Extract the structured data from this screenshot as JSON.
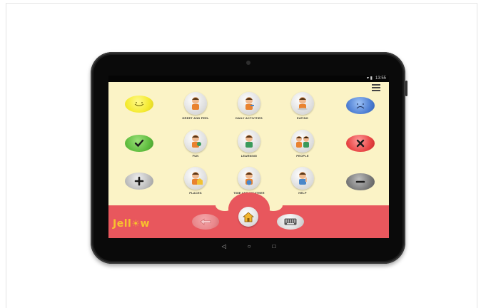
{
  "status": {
    "time": "13:55",
    "icons": "▾ ▮"
  },
  "side_buttons": {
    "left": [
      {
        "name": "yes-smile-button",
        "color": "#f4ea2f",
        "symbol": "smile-icon"
      },
      {
        "name": "yes-check-button",
        "color": "#5fbd3f",
        "symbol": "check-icon"
      },
      {
        "name": "more-plus-button",
        "color": "#b9b9b9",
        "symbol": "plus-icon"
      }
    ],
    "right": [
      {
        "name": "no-sad-button",
        "color": "#4e7fd4",
        "symbol": "sad-icon"
      },
      {
        "name": "no-cross-button",
        "color": "#e84545",
        "symbol": "cross-icon"
      },
      {
        "name": "less-minus-button",
        "color": "#7a7a7a",
        "symbol": "minus-icon"
      }
    ]
  },
  "categories": [
    {
      "label": "GREET AND FEEL"
    },
    {
      "label": "DAILY ACTIVITIES"
    },
    {
      "label": "EATING"
    },
    {
      "label": "FUN"
    },
    {
      "label": "LEARNING"
    },
    {
      "label": "PEOPLE"
    },
    {
      "label": "PLACES"
    },
    {
      "label": "TIME AND WEATHER"
    },
    {
      "label": "HELP"
    }
  ],
  "brand": {
    "logo_text_1": "Jell",
    "logo_text_2": "w",
    "logo_sun": "☀"
  },
  "bottom_nav": {
    "back": "back-arrow-icon",
    "home": "home-icon",
    "keyboard": "keyboard-icon"
  },
  "system_nav": {
    "back": "◁",
    "home": "○",
    "recents": "□"
  },
  "colors": {
    "screen_bg": "#fbf3c6",
    "bar": "#e8575d",
    "logo": "#f8c22e"
  }
}
